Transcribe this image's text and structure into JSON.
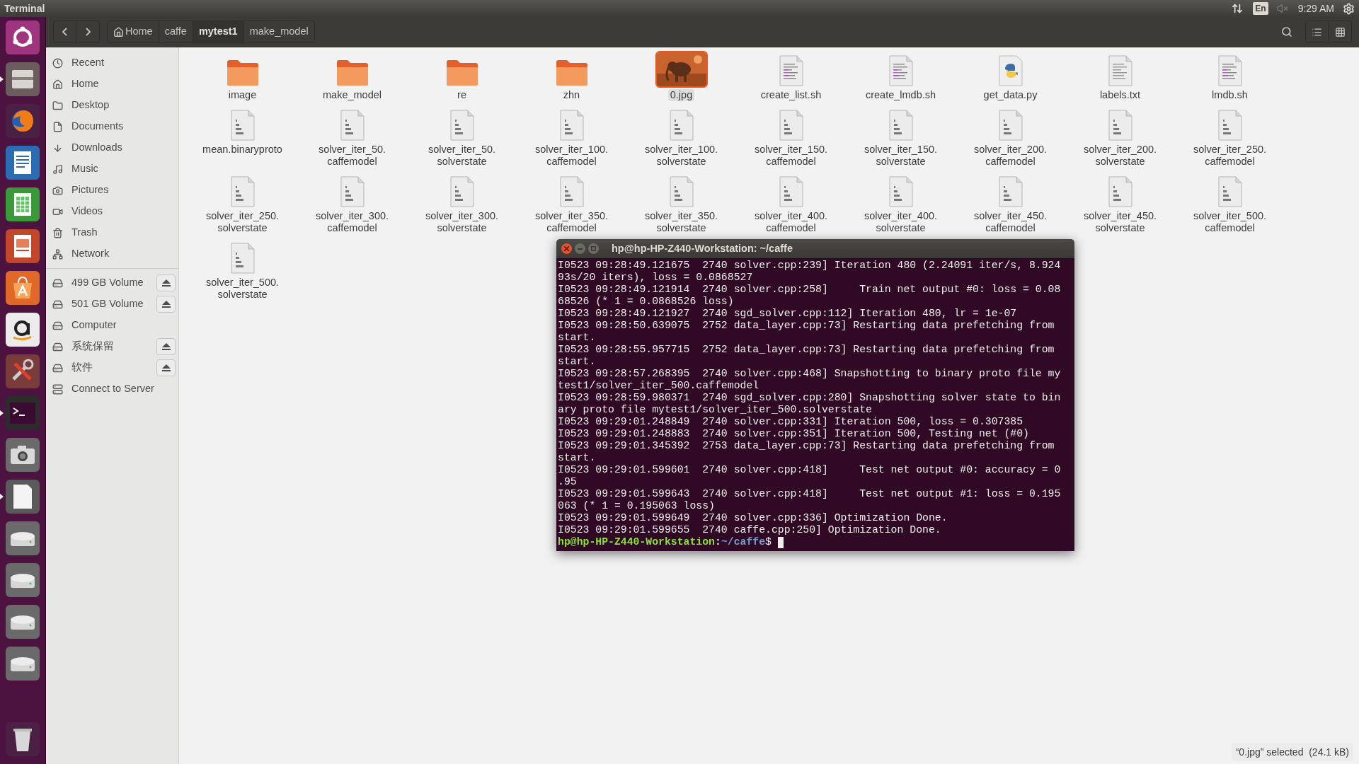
{
  "top_panel": {
    "title": "Terminal",
    "keyboard": "En",
    "time": "9:29 AM"
  },
  "launcher": [
    {
      "kind": "dash"
    },
    {
      "kind": "files",
      "running": true
    },
    {
      "kind": "browser",
      "running": false
    },
    {
      "kind": "writer",
      "running": false
    },
    {
      "kind": "calc",
      "running": false
    },
    {
      "kind": "impress",
      "running": false
    },
    {
      "kind": "store",
      "running": false
    },
    {
      "kind": "amazon",
      "running": false
    },
    {
      "kind": "settings",
      "running": false
    },
    {
      "kind": "terminal",
      "running": true
    },
    {
      "kind": "camera",
      "running": false
    },
    {
      "kind": "document",
      "running": true
    },
    {
      "kind": "drive",
      "running": false
    },
    {
      "kind": "drive",
      "running": false
    },
    {
      "kind": "drive",
      "running": false
    },
    {
      "kind": "drive",
      "running": false
    },
    {
      "kind": "trash",
      "running": false
    }
  ],
  "toolbar": {
    "path": [
      {
        "label": "Home",
        "kind": "home",
        "selected": false
      },
      {
        "label": "caffe",
        "kind": "folder",
        "selected": false
      },
      {
        "label": "mytest1",
        "kind": "folder",
        "selected": true
      },
      {
        "label": "make_model",
        "kind": "folder",
        "selected": false
      }
    ]
  },
  "sidebar": {
    "places": [
      {
        "label": "Recent",
        "kind": "recent"
      },
      {
        "label": "Home",
        "kind": "home"
      },
      {
        "label": "Desktop",
        "kind": "desktop"
      },
      {
        "label": "Documents",
        "kind": "documents"
      },
      {
        "label": "Downloads",
        "kind": "downloads"
      },
      {
        "label": "Music",
        "kind": "music"
      },
      {
        "label": "Pictures",
        "kind": "pictures"
      },
      {
        "label": "Videos",
        "kind": "videos"
      },
      {
        "label": "Trash",
        "kind": "trash"
      },
      {
        "label": "Network",
        "kind": "network"
      }
    ],
    "devices": [
      {
        "label": "499 GB Volume",
        "kind": "drive",
        "eject": true
      },
      {
        "label": "501 GB Volume",
        "kind": "drive",
        "eject": true
      },
      {
        "label": "Computer",
        "kind": "drive",
        "eject": false
      },
      {
        "label": "系统保留",
        "kind": "drive",
        "eject": true
      },
      {
        "label": "软件",
        "kind": "drive",
        "eject": true
      },
      {
        "label": "Connect to Server",
        "kind": "server",
        "eject": false
      }
    ]
  },
  "files": [
    {
      "name": [
        "image"
      ],
      "kind": "folder",
      "selected": false
    },
    {
      "name": [
        "make_model"
      ],
      "kind": "folder",
      "selected": false
    },
    {
      "name": [
        "re"
      ],
      "kind": "folder",
      "selected": false
    },
    {
      "name": [
        "zhn"
      ],
      "kind": "folder",
      "selected": false
    },
    {
      "name": [
        "0.jpg"
      ],
      "selected": true
    },
    {
      "name": [
        "create_list.sh"
      ],
      "kind": "script",
      "selected": false
    },
    {
      "name": [
        "create_lmdb.sh"
      ],
      "kind": "script",
      "selected": false
    },
    {
      "name": [
        "get_data.py"
      ],
      "kind": "python",
      "selected": false
    },
    {
      "name": [
        "labels.txt"
      ],
      "kind": "text",
      "selected": false
    },
    {
      "name": [
        "lmdb.sh"
      ],
      "kind": "script",
      "selected": false
    },
    {
      "name": [
        "mean.binaryproto"
      ],
      "kind": "binary",
      "selected": false
    },
    {
      "name": [
        "solver_iter_50.",
        "caffemodel"
      ],
      "kind": "binary",
      "selected": false
    },
    {
      "name": [
        "solver_iter_50.",
        "solverstate"
      ],
      "kind": "binary",
      "selected": false
    },
    {
      "name": [
        "solver_iter_100.",
        "caffemodel"
      ],
      "kind": "binary",
      "selected": false
    },
    {
      "name": [
        "solver_iter_100.",
        "solverstate"
      ],
      "kind": "binary",
      "selected": false
    },
    {
      "name": [
        "solver_iter_150.",
        "caffemodel"
      ],
      "kind": "binary",
      "selected": false
    },
    {
      "name": [
        "solver_iter_150.",
        "solverstate"
      ],
      "kind": "binary",
      "selected": false
    },
    {
      "name": [
        "solver_iter_200.",
        "caffemodel"
      ],
      "kind": "binary",
      "selected": false
    },
    {
      "name": [
        "solver_iter_200.",
        "solverstate"
      ],
      "kind": "binary",
      "selected": false
    },
    {
      "name": [
        "solver_iter_250.",
        "caffemodel"
      ],
      "kind": "binary",
      "selected": false
    },
    {
      "name": [
        "solver_iter_250.",
        "solverstate"
      ],
      "kind": "binary",
      "selected": false
    },
    {
      "name": [
        "solver_iter_300.",
        "caffemodel"
      ],
      "kind": "binary",
      "selected": false
    },
    {
      "name": [
        "solver_iter_300.",
        "solverstate"
      ],
      "kind": "binary",
      "selected": false
    },
    {
      "name": [
        "solver_iter_350.",
        "caffemodel"
      ],
      "kind": "binary",
      "selected": false
    },
    {
      "name": [
        "solver_iter_350.",
        "solverstate"
      ],
      "kind": "binary",
      "selected": false
    },
    {
      "name": [
        "solver_iter_400.",
        "caffemodel"
      ],
      "kind": "binary",
      "selected": false
    },
    {
      "name": [
        "solver_iter_400.",
        "solverstate"
      ],
      "kind": "binary",
      "selected": false
    },
    {
      "name": [
        "solver_iter_450.",
        "caffemodel"
      ],
      "kind": "binary",
      "selected": false
    },
    {
      "name": [
        "solver_iter_450.",
        "solverstate"
      ],
      "kind": "binary",
      "selected": false
    },
    {
      "name": [
        "solver_iter_500.",
        "caffemodel"
      ],
      "kind": "binary",
      "selected": false
    },
    {
      "name": [
        "solver_iter_500.",
        "solverstate"
      ],
      "kind": "binary",
      "selected": false
    }
  ],
  "terminal": {
    "title": "hp@hp-HP-Z440-Workstation: ~/caffe",
    "lines": [
      "I0523 09:28:49.121675  2740 solver.cpp:239] Iteration 480 (2.24091 iter/s, 8.924",
      "93s/20 iters), loss = 0.0868527",
      "I0523 09:28:49.121914  2740 solver.cpp:258]     Train net output #0: loss = 0.08",
      "68526 (* 1 = 0.0868526 loss)",
      "I0523 09:28:49.121927  2740 sgd_solver.cpp:112] Iteration 480, lr = 1e-07",
      "I0523 09:28:50.639075  2752 data_layer.cpp:73] Restarting data prefetching from",
      "start.",
      "I0523 09:28:55.957715  2752 data_layer.cpp:73] Restarting data prefetching from",
      "start.",
      "I0523 09:28:57.268395  2740 solver.cpp:468] Snapshotting to binary proto file my",
      "test1/solver_iter_500.caffemodel",
      "I0523 09:28:59.980371  2740 sgd_solver.cpp:280] Snapshotting solver state to bin",
      "ary proto file mytest1/solver_iter_500.solverstate",
      "I0523 09:29:01.248849  2740 solver.cpp:331] Iteration 500, loss = 0.307385",
      "I0523 09:29:01.248883  2740 solver.cpp:351] Iteration 500, Testing net (#0)",
      "I0523 09:29:01.345392  2753 data_layer.cpp:73] Restarting data prefetching from",
      "start.",
      "I0523 09:29:01.599601  2740 solver.cpp:418]     Test net output #0: accuracy = 0",
      ".95",
      "I0523 09:29:01.599643  2740 solver.cpp:418]     Test net output #1: loss = 0.195",
      "063 (* 1 = 0.195063 loss)",
      "I0523 09:29:01.599649  2740 solver.cpp:336] Optimization Done.",
      "I0523 09:29:01.599655  2740 caffe.cpp:250] Optimization Done."
    ],
    "prompt": {
      "user_host": "hp@hp-HP-Z440-Workstation",
      "separator": ":",
      "path": "~/caffe",
      "symbol": "$"
    }
  },
  "status": "“0.jpg” selected  (24.1 kB)"
}
